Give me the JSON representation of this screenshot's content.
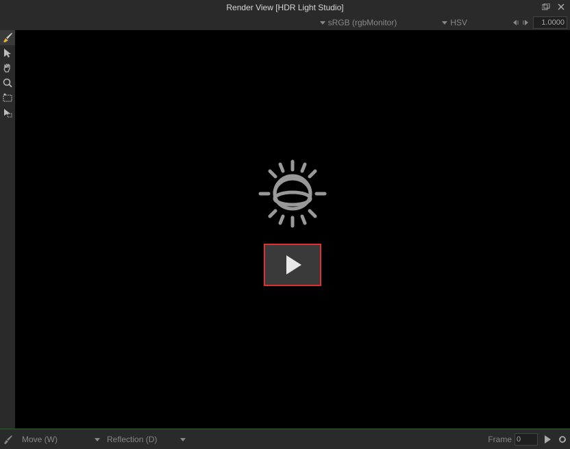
{
  "titlebar": {
    "title": "Render View [HDR Light Studio]"
  },
  "topbar": {
    "colorspace": "sRGB (rgbMonitor)",
    "model": "HSV",
    "exposure": "1.0000"
  },
  "statusbar": {
    "transform": "Move (W)",
    "mode": "Reflection (D)",
    "frame_label": "Frame",
    "frame_value": "0"
  },
  "tools": {
    "brush": "brush-tool",
    "select": "select-tool",
    "pan": "pan-tool",
    "zoom": "zoom-tool",
    "region": "region-tool",
    "pick": "pick-tool"
  }
}
